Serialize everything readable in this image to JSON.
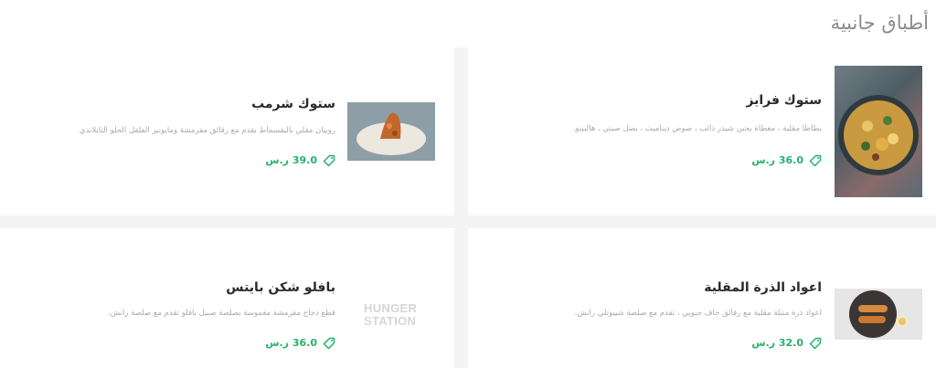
{
  "section": {
    "title": "أطباق جانبية"
  },
  "items": [
    {
      "name": "ستوك فرايز",
      "description": "بطاطا مقلية ، مغطاة بجبن شيدر ذائب ، صوص ديناميت ، بصل صيني ، هالبينو.",
      "price": "36.0 ر.س"
    },
    {
      "name": "ستوك شرمب",
      "description": "روبيان مقلي بالبقسماط يقدم مع رقائق مقرمشة ومايونيز الفلفل الحلو التايلاندي",
      "price": "39.0 ر.س"
    },
    {
      "name": "اعواد الذرة المقلية",
      "description": "اعواد ذرة متبلة مقلية مع رقائق جاف جبويي ، تقدم مع صلصة شيبوتلي رانش.",
      "price": "32.0 ر.س"
    },
    {
      "name": "بافلو شكن بايتس",
      "description": "قطع دجاج مقرمشة مغموسة بصلصة صبيل بافلو تقدم مع صلصة رانش.",
      "price": "36.0 ر.س"
    }
  ],
  "watermark": {
    "line1": "HUNGER",
    "line2": "STATION"
  },
  "colors": {
    "accent": "#25b26b"
  },
  "icons": {
    "price": "price-tag-icon"
  }
}
